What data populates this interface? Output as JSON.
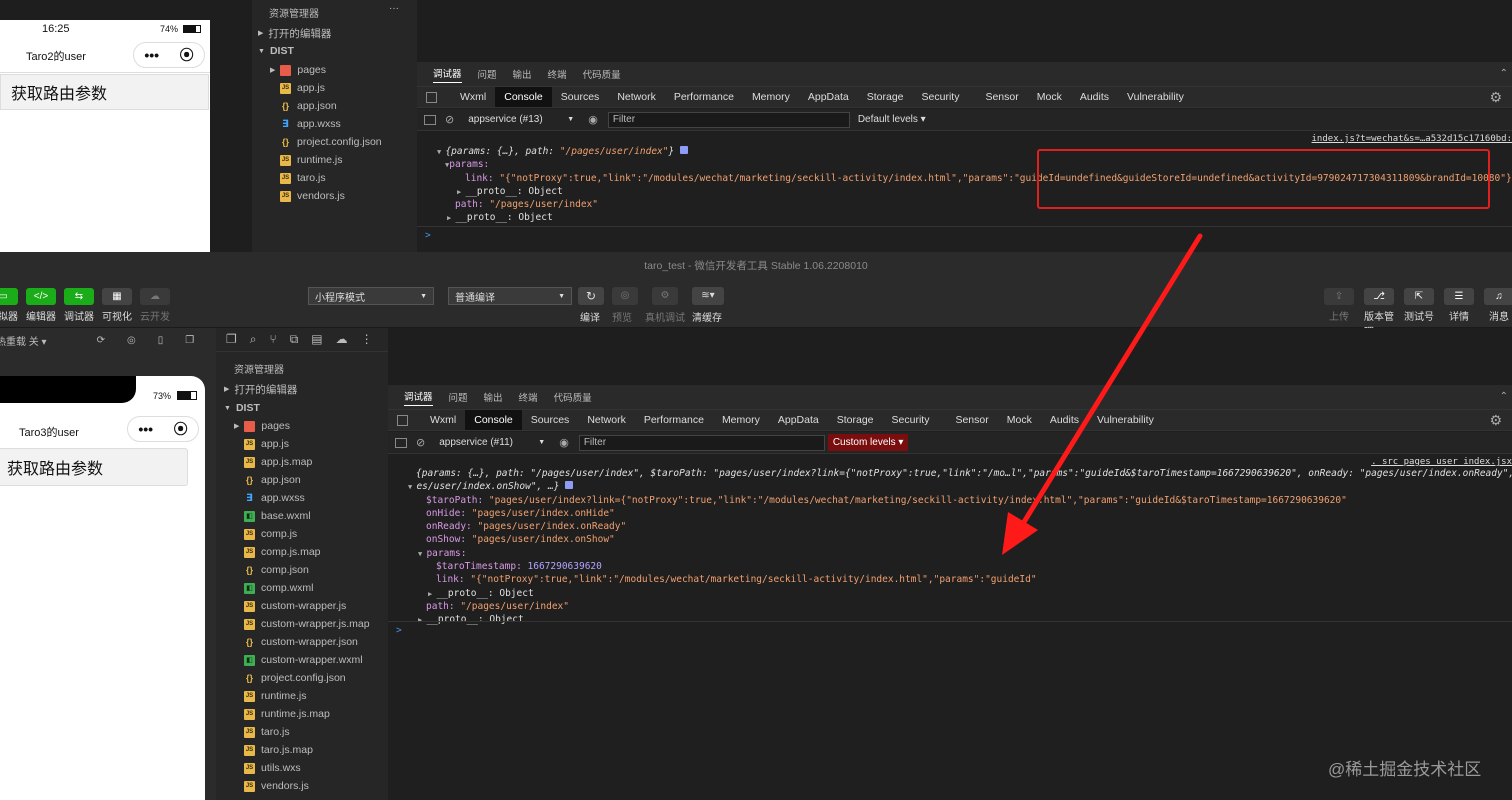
{
  "top": {
    "phone": {
      "time": "16:25",
      "battery": "74%",
      "title": "Taro2的user",
      "more": "•••",
      "record": "⦿",
      "button": "获取路由参数"
    },
    "explorer": {
      "header": "资源管理器",
      "menu": "···",
      "open_editors": "打开的编辑器",
      "dist": "DIST",
      "files": [
        {
          "name": "pages",
          "type": "folder"
        },
        {
          "name": "app.js",
          "type": "js"
        },
        {
          "name": "app.json",
          "type": "json"
        },
        {
          "name": "app.wxss",
          "type": "wxss"
        },
        {
          "name": "project.config.json",
          "type": "json"
        },
        {
          "name": "runtime.js",
          "type": "js"
        },
        {
          "name": "taro.js",
          "type": "js"
        },
        {
          "name": "vendors.js",
          "type": "js"
        }
      ]
    },
    "devtools": {
      "subtabs": [
        "调试器",
        "问题",
        "输出",
        "终端",
        "代码质量"
      ],
      "tabs": [
        "Wxml",
        "Console",
        "Sources",
        "Network",
        "Performance",
        "Memory",
        "AppData",
        "Storage",
        "Security",
        "Sensor",
        "Mock",
        "Audits",
        "Vulnerability"
      ],
      "context": "appservice (#13)",
      "filter_placeholder": "Filter",
      "levels": "Default levels ▾",
      "source_link": "index.js?t=wechat&s=…a532d15c17160bd:",
      "console": {
        "l1_a": "{params: {…}, path: ",
        "l1_b": "\"/pages/user/index\"",
        "l1_c": "}",
        "l2": "params:",
        "l3_key": "link: ",
        "l3_val": "\"{\"notProxy\":true,\"link\":\"/modules/wechat/marketing/seckill-activity/index.html\",\"params\":\"guideId=undefined&guideStoreId=undefined&activityId=979024717304311809&brandId=10080\"}\"",
        "l4": "__proto__: Object",
        "l5_key": "path: ",
        "l5_val": "\"/pages/user/index\"",
        "l6": "__proto__: Object",
        "prompt": ">"
      }
    }
  },
  "window_title": "taro_test - 微信开发者工具 Stable 1.06.2208010",
  "toolbar": {
    "left_buttons": [
      {
        "label": "模拟器",
        "icon": "▭"
      },
      {
        "label": "编辑器",
        "icon": "</>"
      },
      {
        "label": "调试器",
        "icon": "⇆"
      },
      {
        "label": "可视化",
        "icon": "▦"
      },
      {
        "label": "云开发",
        "icon": "☁"
      }
    ],
    "mode_select": "小程序模式",
    "compile_select": "普通编译",
    "mid_buttons": [
      "编译",
      "预览",
      "真机调试",
      "清缓存"
    ],
    "right_buttons": [
      "上传",
      "版本管理",
      "测试号",
      "详情",
      "消息"
    ]
  },
  "bottom": {
    "sim_bar": "热重载 关 ▾",
    "phone": {
      "battery": "73%",
      "title": "Taro3的user",
      "more": "•••",
      "record": "⦿",
      "button": "获取路由参数"
    },
    "explorer": {
      "header": "资源管理器",
      "open_editors": "打开的编辑器",
      "dist": "DIST",
      "files": [
        {
          "name": "pages",
          "type": "folder"
        },
        {
          "name": "app.js",
          "type": "js"
        },
        {
          "name": "app.js.map",
          "type": "map"
        },
        {
          "name": "app.json",
          "type": "json"
        },
        {
          "name": "app.wxss",
          "type": "wxss"
        },
        {
          "name": "base.wxml",
          "type": "wxml"
        },
        {
          "name": "comp.js",
          "type": "js"
        },
        {
          "name": "comp.js.map",
          "type": "map"
        },
        {
          "name": "comp.json",
          "type": "json"
        },
        {
          "name": "comp.wxml",
          "type": "wxml"
        },
        {
          "name": "custom-wrapper.js",
          "type": "js"
        },
        {
          "name": "custom-wrapper.js.map",
          "type": "map"
        },
        {
          "name": "custom-wrapper.json",
          "type": "json"
        },
        {
          "name": "custom-wrapper.wxml",
          "type": "wxml"
        },
        {
          "name": "project.config.json",
          "type": "json"
        },
        {
          "name": "runtime.js",
          "type": "js"
        },
        {
          "name": "runtime.js.map",
          "type": "map"
        },
        {
          "name": "taro.js",
          "type": "js"
        },
        {
          "name": "taro.js.map",
          "type": "map"
        },
        {
          "name": "utils.wxs",
          "type": "js"
        },
        {
          "name": "vendors.js",
          "type": "js"
        }
      ]
    },
    "devtools": {
      "subtabs": [
        "调试器",
        "问题",
        "输出",
        "终端",
        "代码质量"
      ],
      "tabs": [
        "Wxml",
        "Console",
        "Sources",
        "Network",
        "Performance",
        "Memory",
        "AppData",
        "Storage",
        "Security",
        "Sensor",
        "Mock",
        "Audits",
        "Vulnerability"
      ],
      "context": "appservice (#11)",
      "filter_placeholder": "Filter",
      "levels": "Custom levels ▾",
      "source_link": ". src_pages_user_index.jsx",
      "console": {
        "l1": "{params: {…}, path: \"/pages/user/index\", $taroPath: \"pages/user/index?link={\"notProxy\":true,\"link\":\"/mo…l\",\"params\":\"guideId&$taroTimestamp=1667290639620\", onReady: \"pages/user/index.onReady\", onShow: \"pag",
        "l1b": "es/user/index.onShow\", …}",
        "l2_key": "$taroPath: ",
        "l2_val": "\"pages/user/index?link={\"notProxy\":true,\"link\":\"/modules/wechat/marketing/seckill-activity/index.html\",\"params\":\"guideId&$taroTimestamp=1667290639620\"",
        "l3_key": "onHide: ",
        "l3_val": "\"pages/user/index.onHide\"",
        "l4_key": "onReady: ",
        "l4_val": "\"pages/user/index.onReady\"",
        "l5_key": "onShow: ",
        "l5_val": "\"pages/user/index.onShow\"",
        "l6": "params:",
        "l7_key": "$taroTimestamp: ",
        "l7_val": "1667290639620",
        "l8_key": "link: ",
        "l8_val": "\"{\"notProxy\":true,\"link\":\"/modules/wechat/marketing/seckill-activity/index.html\",\"params\":\"guideId\"",
        "l9": "__proto__: Object",
        "l10_key": "path: ",
        "l10_val": "\"/pages/user/index\"",
        "l11": "__proto__: Object",
        "prompt": ">"
      }
    }
  },
  "watermark": "@稀土掘金技术社区",
  "colors": {
    "highlight_box": "#e0201e",
    "arrow": "#ff1a1a",
    "green": "#1aad19"
  }
}
